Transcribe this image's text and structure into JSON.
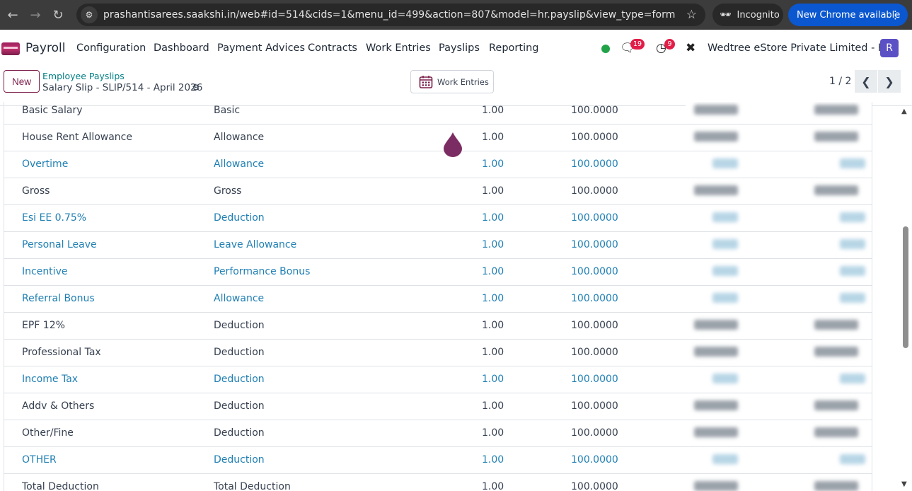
{
  "browser": {
    "url": "prashantisarees.saakshi.in/web#id=514&cids=1&menu_id=499&action=807&model=hr.payslip&view_type=form",
    "incognito_label": "Incognito",
    "update_label": "New Chrome available"
  },
  "nav": {
    "app_name": "Payroll",
    "menu": [
      "Configuration",
      "Dashboard",
      "Payment Advices",
      "Contracts",
      "Work Entries",
      "Payslips",
      "Reporting"
    ],
    "messages_count": "19",
    "activities_count": "9",
    "company": "Wedtree eStore Private Limited - HO",
    "avatar_letter": "R"
  },
  "control_panel": {
    "new_label": "New",
    "breadcrumb_parent": "Employee Payslips",
    "breadcrumb_current": "Salary Slip - SLIP/514 - April 2026",
    "work_entries_label": "Work Entries",
    "pager": "1 / 2"
  },
  "lines": [
    {
      "name": "Basic Salary",
      "category": "Basic",
      "quantity": "1.00",
      "rate": "100.0000",
      "link": false
    },
    {
      "name": "House Rent Allowance",
      "category": "Allowance",
      "quantity": "1.00",
      "rate": "100.0000",
      "link": false
    },
    {
      "name": "Overtime",
      "category": "Allowance",
      "quantity": "1.00",
      "rate": "100.0000",
      "link": true
    },
    {
      "name": "Gross",
      "category": "Gross",
      "quantity": "1.00",
      "rate": "100.0000",
      "link": false
    },
    {
      "name": "Esi EE 0.75%",
      "category": "Deduction",
      "quantity": "1.00",
      "rate": "100.0000",
      "link": true
    },
    {
      "name": "Personal Leave",
      "category": "Leave Allowance",
      "quantity": "1.00",
      "rate": "100.0000",
      "link": true
    },
    {
      "name": "Incentive",
      "category": "Performance Bonus",
      "quantity": "1.00",
      "rate": "100.0000",
      "link": true
    },
    {
      "name": "Referral Bonus",
      "category": "Allowance",
      "quantity": "1.00",
      "rate": "100.0000",
      "link": true
    },
    {
      "name": "EPF 12%",
      "category": "Deduction",
      "quantity": "1.00",
      "rate": "100.0000",
      "link": false
    },
    {
      "name": "Professional Tax",
      "category": "Deduction",
      "quantity": "1.00",
      "rate": "100.0000",
      "link": false
    },
    {
      "name": "Income Tax",
      "category": "Deduction",
      "quantity": "1.00",
      "rate": "100.0000",
      "link": true
    },
    {
      "name": "Addv & Others",
      "category": "Deduction",
      "quantity": "1.00",
      "rate": "100.0000",
      "link": false
    },
    {
      "name": "Other/Fine",
      "category": "Deduction",
      "quantity": "1.00",
      "rate": "100.0000",
      "link": false
    },
    {
      "name": "OTHER",
      "category": "Deduction",
      "quantity": "1.00",
      "rate": "100.0000",
      "link": true
    },
    {
      "name": "Total Deduction",
      "category": "Total Deduction",
      "quantity": "1.00",
      "rate": "100.0000",
      "link": false
    }
  ],
  "colors": {
    "brand": "#7b1f4a",
    "link": "#1f7fb3",
    "teal": "#017e84",
    "badge": "#e11d48",
    "online": "#22a34a"
  }
}
